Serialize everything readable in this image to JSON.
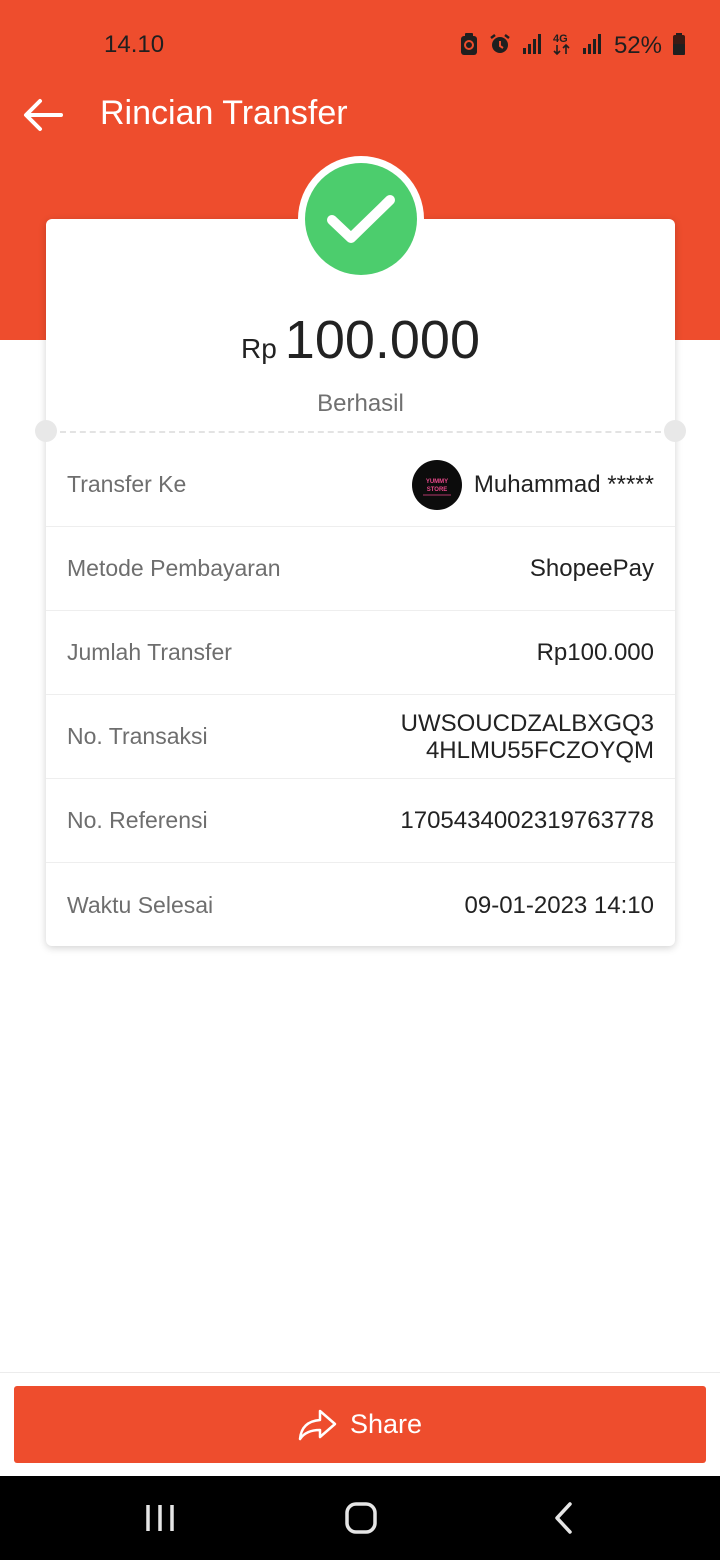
{
  "status_bar": {
    "time": "14.10",
    "battery_percent": "52%",
    "network_type": "4G",
    "icons": [
      "cleaner-icon",
      "alarm-icon",
      "signal-icon",
      "4g-data-icon",
      "signal-icon",
      "battery-icon"
    ]
  },
  "app_bar": {
    "title": "Rincian Transfer",
    "back_icon": "arrow-left-icon"
  },
  "summary": {
    "currency": "Rp",
    "amount": "100.000",
    "status": "Berhasil",
    "status_icon": "check-icon"
  },
  "details": {
    "transfer_to": {
      "label": "Transfer Ke",
      "value": "Muhammad *****",
      "avatar_text": "YUMMY STORE"
    },
    "payment_method": {
      "label": "Metode Pembayaran",
      "value": "ShopeePay"
    },
    "transfer_amount": {
      "label": "Jumlah Transfer",
      "value": "Rp100.000"
    },
    "transaction_no": {
      "label": "No. Transaksi",
      "value": "UWSOUCDZALBXGQ34HLMU55FCZOYQM"
    },
    "reference_no": {
      "label": "No. Referensi",
      "value": "1705434002319763778"
    },
    "completed_time": {
      "label": "Waktu Selesai",
      "value": "09-01-2023 14:10"
    }
  },
  "actions": {
    "share_label": "Share",
    "share_icon": "share-arrow-icon"
  },
  "nav": {
    "recents_icon": "recents-icon",
    "home_icon": "home-icon",
    "back_icon": "nav-back-icon"
  },
  "colors": {
    "brand": "#ee4d2d",
    "success": "#4ccd6d",
    "text": "#222222",
    "muted": "#6e6e6e"
  }
}
